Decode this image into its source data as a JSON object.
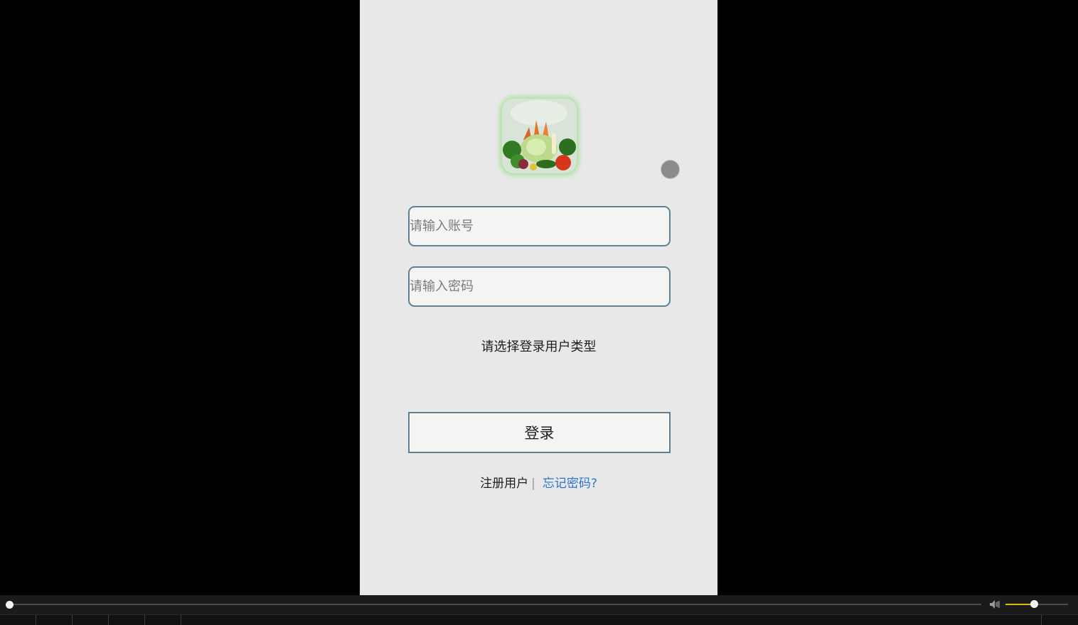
{
  "app": {
    "logo_icon": "vegetable-basket-logo",
    "float_button_icon": "floating-dot-icon"
  },
  "login": {
    "account_placeholder": "请输入账号",
    "password_placeholder": "请输入密码",
    "user_type_prompt": "请选择登录用户类型",
    "login_label": "登录",
    "register_label": "注册用户",
    "separator": "|",
    "forgot_label": "忘记密码?"
  },
  "player": {
    "playback_progress": 0.0,
    "volume_level": 0.45,
    "volume_icon": "speaker-icon",
    "accent_color": "#e3b70f"
  },
  "colors": {
    "page_background": "#e8e8e8",
    "input_border": "#5e8291",
    "link_color": "#2f73c8"
  }
}
